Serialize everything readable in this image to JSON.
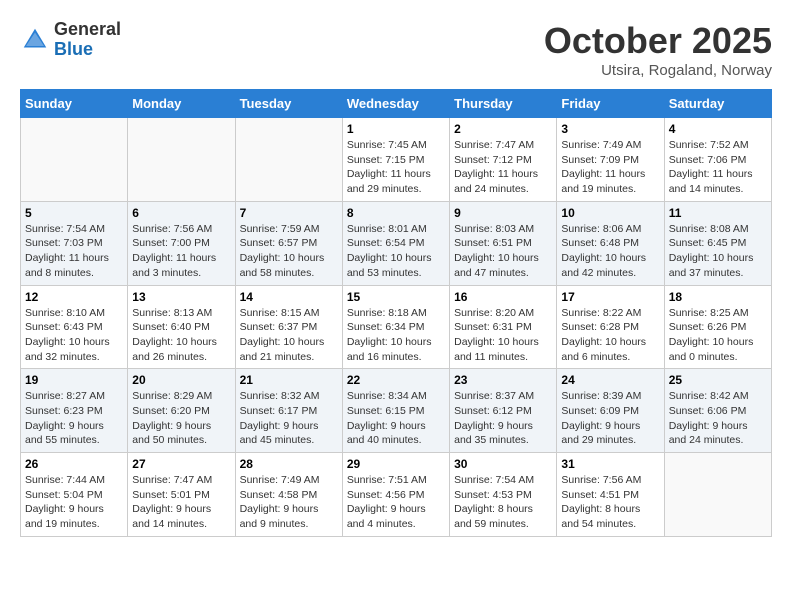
{
  "header": {
    "logo_general": "General",
    "logo_blue": "Blue",
    "month_title": "October 2025",
    "location": "Utsira, Rogaland, Norway"
  },
  "days_of_week": [
    "Sunday",
    "Monday",
    "Tuesday",
    "Wednesday",
    "Thursday",
    "Friday",
    "Saturday"
  ],
  "weeks": [
    [
      {
        "day": "",
        "info": ""
      },
      {
        "day": "",
        "info": ""
      },
      {
        "day": "",
        "info": ""
      },
      {
        "day": "1",
        "info": "Sunrise: 7:45 AM\nSunset: 7:15 PM\nDaylight: 11 hours\nand 29 minutes."
      },
      {
        "day": "2",
        "info": "Sunrise: 7:47 AM\nSunset: 7:12 PM\nDaylight: 11 hours\nand 24 minutes."
      },
      {
        "day": "3",
        "info": "Sunrise: 7:49 AM\nSunset: 7:09 PM\nDaylight: 11 hours\nand 19 minutes."
      },
      {
        "day": "4",
        "info": "Sunrise: 7:52 AM\nSunset: 7:06 PM\nDaylight: 11 hours\nand 14 minutes."
      }
    ],
    [
      {
        "day": "5",
        "info": "Sunrise: 7:54 AM\nSunset: 7:03 PM\nDaylight: 11 hours\nand 8 minutes."
      },
      {
        "day": "6",
        "info": "Sunrise: 7:56 AM\nSunset: 7:00 PM\nDaylight: 11 hours\nand 3 minutes."
      },
      {
        "day": "7",
        "info": "Sunrise: 7:59 AM\nSunset: 6:57 PM\nDaylight: 10 hours\nand 58 minutes."
      },
      {
        "day": "8",
        "info": "Sunrise: 8:01 AM\nSunset: 6:54 PM\nDaylight: 10 hours\nand 53 minutes."
      },
      {
        "day": "9",
        "info": "Sunrise: 8:03 AM\nSunset: 6:51 PM\nDaylight: 10 hours\nand 47 minutes."
      },
      {
        "day": "10",
        "info": "Sunrise: 8:06 AM\nSunset: 6:48 PM\nDaylight: 10 hours\nand 42 minutes."
      },
      {
        "day": "11",
        "info": "Sunrise: 8:08 AM\nSunset: 6:45 PM\nDaylight: 10 hours\nand 37 minutes."
      }
    ],
    [
      {
        "day": "12",
        "info": "Sunrise: 8:10 AM\nSunset: 6:43 PM\nDaylight: 10 hours\nand 32 minutes."
      },
      {
        "day": "13",
        "info": "Sunrise: 8:13 AM\nSunset: 6:40 PM\nDaylight: 10 hours\nand 26 minutes."
      },
      {
        "day": "14",
        "info": "Sunrise: 8:15 AM\nSunset: 6:37 PM\nDaylight: 10 hours\nand 21 minutes."
      },
      {
        "day": "15",
        "info": "Sunrise: 8:18 AM\nSunset: 6:34 PM\nDaylight: 10 hours\nand 16 minutes."
      },
      {
        "day": "16",
        "info": "Sunrise: 8:20 AM\nSunset: 6:31 PM\nDaylight: 10 hours\nand 11 minutes."
      },
      {
        "day": "17",
        "info": "Sunrise: 8:22 AM\nSunset: 6:28 PM\nDaylight: 10 hours\nand 6 minutes."
      },
      {
        "day": "18",
        "info": "Sunrise: 8:25 AM\nSunset: 6:26 PM\nDaylight: 10 hours\nand 0 minutes."
      }
    ],
    [
      {
        "day": "19",
        "info": "Sunrise: 8:27 AM\nSunset: 6:23 PM\nDaylight: 9 hours\nand 55 minutes."
      },
      {
        "day": "20",
        "info": "Sunrise: 8:29 AM\nSunset: 6:20 PM\nDaylight: 9 hours\nand 50 minutes."
      },
      {
        "day": "21",
        "info": "Sunrise: 8:32 AM\nSunset: 6:17 PM\nDaylight: 9 hours\nand 45 minutes."
      },
      {
        "day": "22",
        "info": "Sunrise: 8:34 AM\nSunset: 6:15 PM\nDaylight: 9 hours\nand 40 minutes."
      },
      {
        "day": "23",
        "info": "Sunrise: 8:37 AM\nSunset: 6:12 PM\nDaylight: 9 hours\nand 35 minutes."
      },
      {
        "day": "24",
        "info": "Sunrise: 8:39 AM\nSunset: 6:09 PM\nDaylight: 9 hours\nand 29 minutes."
      },
      {
        "day": "25",
        "info": "Sunrise: 8:42 AM\nSunset: 6:06 PM\nDaylight: 9 hours\nand 24 minutes."
      }
    ],
    [
      {
        "day": "26",
        "info": "Sunrise: 7:44 AM\nSunset: 5:04 PM\nDaylight: 9 hours\nand 19 minutes."
      },
      {
        "day": "27",
        "info": "Sunrise: 7:47 AM\nSunset: 5:01 PM\nDaylight: 9 hours\nand 14 minutes."
      },
      {
        "day": "28",
        "info": "Sunrise: 7:49 AM\nSunset: 4:58 PM\nDaylight: 9 hours\nand 9 minutes."
      },
      {
        "day": "29",
        "info": "Sunrise: 7:51 AM\nSunset: 4:56 PM\nDaylight: 9 hours\nand 4 minutes."
      },
      {
        "day": "30",
        "info": "Sunrise: 7:54 AM\nSunset: 4:53 PM\nDaylight: 8 hours\nand 59 minutes."
      },
      {
        "day": "31",
        "info": "Sunrise: 7:56 AM\nSunset: 4:51 PM\nDaylight: 8 hours\nand 54 minutes."
      },
      {
        "day": "",
        "info": ""
      }
    ]
  ]
}
